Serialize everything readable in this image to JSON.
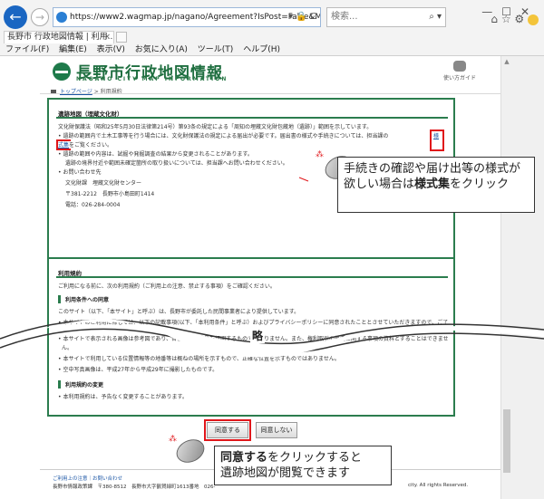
{
  "browser": {
    "url": "https://www2.wagmap.jp/nagano/Agreement?IsPost=False&MapId=7&Reque",
    "search_placeholder": "検索...",
    "tab_title": "長野市 行政地図情報 | 利用...",
    "menu": [
      "ファイル(F)",
      "編集(E)",
      "表示(V)",
      "お気に入り(A)",
      "ツール(T)",
      "ヘルプ(H)"
    ]
  },
  "site": {
    "title": "長野市行政地図情報",
    "subtitle": "NAGANO CITY MAP INFORMATION",
    "guide_label": "使い方ガイド",
    "breadcrumb_top": "トップページ",
    "breadcrumb_current": "利用規約"
  },
  "box1": {
    "title": "遺跡地図（埋蔵文化財）",
    "line1": "文化財保護法（昭和25年5月30日法律第214号）第93条の規定による「周知の埋蔵文化財包蔵地（遺跡）」範囲を示しています。",
    "line2": "• 遺跡の範囲内で土木工事等を行う場合には、文化財保護法の規定による届出が必要です。届出書の様式や手続きについては、担当課の",
    "link1": "様",
    "link2": "式集",
    "line3": "をご覧ください。",
    "line4": "• 遺跡の範囲や内容は、試掘や発掘調査の結果から変更されることがあります。",
    "line5": "遺跡の境界付近や範囲未確定箇所の取り扱いについては、担当課へお問い合わせください。",
    "line6": "• お問い合わせ先",
    "line7": "文化財課　埋蔵文化財センター",
    "line8": "〒381-2212　長野市小島田町1414",
    "line9": "電話：026-284-0004"
  },
  "box2": {
    "title": "利用規約",
    "intro": "ご利用になる前に、次の利用規約（ご利用上の注意、禁止する事項）をご確認ください。",
    "h1": "利用条件への同意",
    "p1": "このサイト（以下、「本サイト」と呼ぶ）は、長野市が委託した民間事業者により提供しています。",
    "p2": "• 本サイトのご利用に際しては、以下の記載事項(以下、「本利用条件」と呼ぶ）およびプライバシーポリシーに同意されたこととさせていただきますので、ご了",
    "p3": "• 本サイトで表示される画像は参考図であり、各種土地の境界を証明するものではありません。また、権利取引の概要に関する事項の資料とすることはできませ",
    "p3b": "ん。",
    "p4": "• 本サイトで利用している位置情報等の地番等は概ねの場所を示すもので、正確な位置を示すものではありません。",
    "p5": "• 空中写真画像は、平成27年から平成29年に撮影したものです。",
    "h2": "利用規約の変更",
    "p6": "• 本利用規約は、予告なく変更することがあります。"
  },
  "buttons": {
    "agree": "同意する",
    "disagree": "同意しない"
  },
  "footer": {
    "links": "ご利用上の注意｜お問い合わせ",
    "org": "長野市情報政策課　〒380-8512　長野市大字鶴賀緑町1613番地　026-",
    "copyright": "city. All rights Reserved."
  },
  "annotations": {
    "omit": "略",
    "callout1": "手続きの確認や届け出等の様式が欲しい場合は",
    "callout1_bold": "様式集",
    "callout1_end": "をクリック",
    "callout2_bold": "同意する",
    "callout2_mid": "をクリックすると",
    "callout2_end": "遺跡地図が閲覧できます"
  },
  "colors": {
    "accent": "#2b7d4e",
    "highlight": "#e0161a",
    "link": "#1a55a5"
  }
}
